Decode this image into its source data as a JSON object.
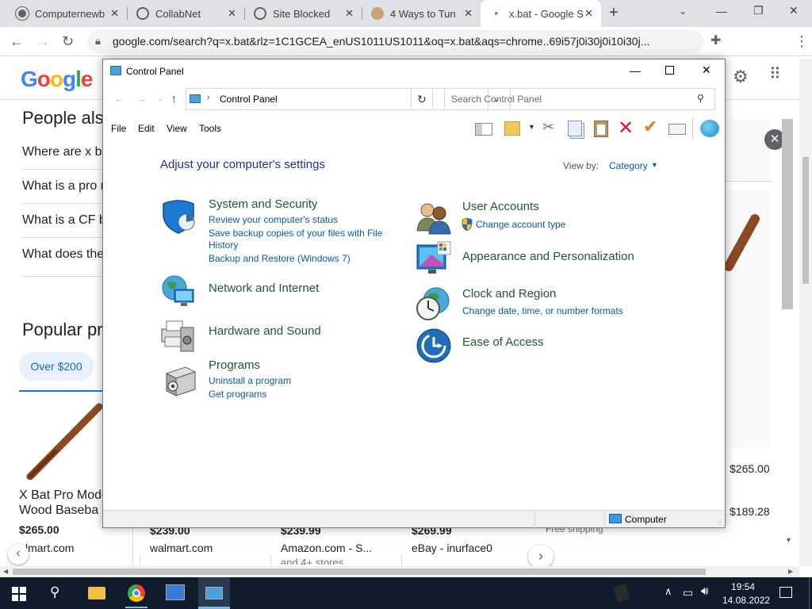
{
  "browser": {
    "tabs": [
      {
        "label": "Computernewb",
        "color": "#5f6368"
      },
      {
        "label": "CollabNet",
        "color": "#5f6368"
      },
      {
        "label": "Site Blocked",
        "color": "#5f6368"
      },
      {
        "label": "4 Ways to Turn",
        "color": "#a0522d"
      },
      {
        "label": "x.bat - Google S",
        "color": "#4285f4"
      }
    ],
    "new_tab": "+",
    "url": "google.com/search?q=x.bat&rlz=1C1GCEA_enUS1011US1011&oq=x.bat&aqs=chrome..69i57j0i30j0i10i30j...",
    "window_controls": {
      "minimize": "—",
      "restore": "❐",
      "close": "✕"
    }
  },
  "google": {
    "logo": "Google",
    "people_also": "People also",
    "questions": [
      "Where are x b",
      "What is a pro r",
      "What is a CF b",
      "What does the"
    ],
    "popular": "Popular pr",
    "chip": "Over $200",
    "products": [
      {
        "title1": "X Bat Pro Mode",
        "title2": "Wood Baseba",
        "price": "$265.00",
        "store": "lmart.com"
      },
      {
        "price": "$239.00",
        "store": "walmart.com"
      },
      {
        "price": "$239.99",
        "store": "Amazon.com - S...",
        "sub": "and 4+ stores"
      },
      {
        "price": "$269.99",
        "store": "eBay - inurface0"
      }
    ],
    "shipping": "Free shipping",
    "right_prices": [
      "$265.00",
      "$189.28"
    ]
  },
  "control_panel": {
    "title": "Control Panel",
    "address": "Control Panel",
    "search_placeholder": "Search Control Panel",
    "menu": [
      "File",
      "Edit",
      "View",
      "Tools"
    ],
    "heading": "Adjust your computer's settings",
    "view_by_label": "View by:",
    "view_by_value": "Category",
    "status": "Computer",
    "categories_left": [
      {
        "name": "System and Security",
        "links": [
          "Review your computer's status",
          "Save backup copies of your files with File",
          "History",
          "Backup and Restore (Windows 7)"
        ]
      },
      {
        "name": "Network and Internet",
        "links": []
      },
      {
        "name": "Hardware and Sound",
        "links": []
      },
      {
        "name": "Programs",
        "links": [
          "Uninstall a program",
          "Get programs"
        ]
      }
    ],
    "categories_right": [
      {
        "name": "User Accounts",
        "links": [
          "Change account type"
        ]
      },
      {
        "name": "Appearance and Personalization",
        "links": []
      },
      {
        "name": "Clock and Region",
        "links": [
          "Change date, time, or number formats"
        ]
      },
      {
        "name": "Ease of Access",
        "links": []
      }
    ]
  },
  "taskbar": {
    "time": "19:54",
    "date": "14.08.2022"
  }
}
